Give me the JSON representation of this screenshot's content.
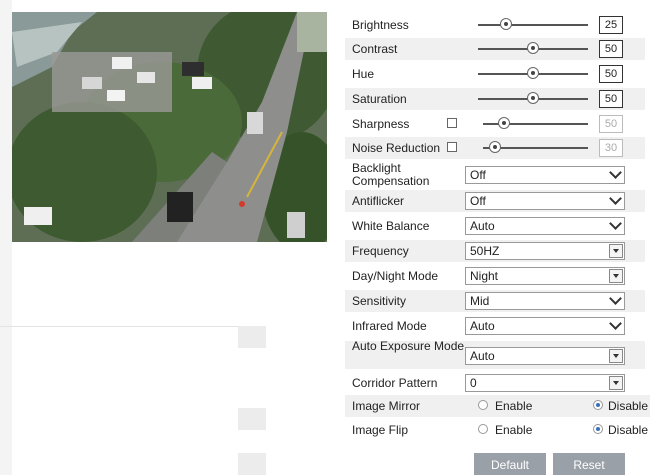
{
  "settings": {
    "brightness": {
      "label": "Brightness",
      "value": "25",
      "level": 0.25
    },
    "contrast": {
      "label": "Contrast",
      "value": "50",
      "level": 0.5
    },
    "hue": {
      "label": "Hue",
      "value": "50",
      "level": 0.5
    },
    "saturation": {
      "label": "Saturation",
      "value": "50",
      "level": 0.5
    },
    "sharpness": {
      "label": "Sharpness",
      "value": "50",
      "level": 0.2
    },
    "noise_reduction": {
      "label": "Noise Reduction",
      "value": "30",
      "level": 0.1
    },
    "backlight": {
      "label": "Backlight Compensation",
      "value": "Off"
    },
    "antiflicker": {
      "label": "Antiflicker",
      "value": "Off"
    },
    "white_balance": {
      "label": "White Balance",
      "value": "Auto"
    },
    "frequency": {
      "label": "Frequency",
      "value": "50HZ"
    },
    "day_night": {
      "label": "Day/Night Mode",
      "value": "Night"
    },
    "sensitivity": {
      "label": "Sensitivity",
      "value": "Mid"
    },
    "infrared": {
      "label": "Infrared Mode",
      "value": "Auto"
    },
    "auto_exposure": {
      "label": "Auto Exposure Mode",
      "value": "Auto"
    },
    "corridor": {
      "label": "Corridor Pattern",
      "value": "0"
    },
    "image_mirror": {
      "label": "Image Mirror",
      "enable": "Enable",
      "disable": "Disable",
      "selected": "Disable"
    },
    "image_flip": {
      "label": "Image Flip",
      "enable": "Enable",
      "disable": "Disable",
      "selected": "Disable"
    }
  },
  "buttons": {
    "default": "Default",
    "reset": "Reset"
  }
}
